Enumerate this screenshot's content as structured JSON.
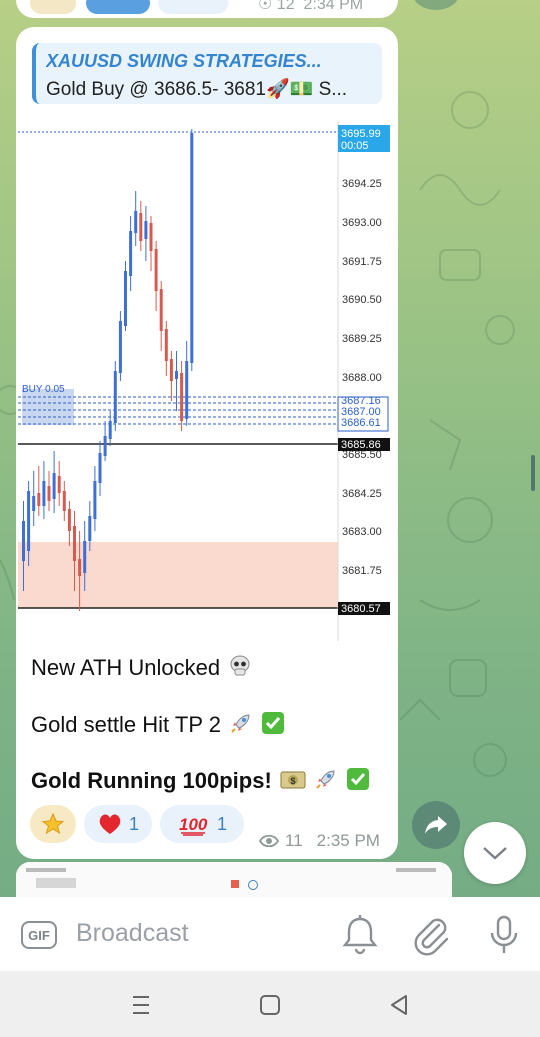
{
  "previous_message": {
    "views": "12",
    "time": "2:34 PM"
  },
  "reply": {
    "title": "XAUUSD SWING STRATEGIES...",
    "text": "Gold Buy @ 3686.5- 3681🚀💵 S..."
  },
  "chart": {
    "price_labels": [
      "3694.25",
      "3693.00",
      "3691.75",
      "3690.50",
      "3689.25",
      "3688.00",
      "3685.50",
      "3684.25",
      "3683.00",
      "3681.75"
    ],
    "tag_top_price": "3695.99",
    "tag_top_time": "00:05",
    "tag_orders": [
      "3687.16",
      "3687.00",
      "3686.61"
    ],
    "tag_current": "3685.86",
    "tag_bottom": "3680.57",
    "buy_label": "BUY 0.05"
  },
  "message": {
    "line1": "New ATH Unlocked",
    "line2": "Gold settle Hit TP 2",
    "line3": "Gold Running 100pips!"
  },
  "reactions": [
    {
      "icon": "star",
      "count": ""
    },
    {
      "icon": "heart",
      "count": "1"
    },
    {
      "icon": "hundred",
      "count": "1"
    }
  ],
  "meta": {
    "views": "11",
    "time": "2:35 PM"
  },
  "input": {
    "placeholder": "Broadcast",
    "gif_label": "GIF"
  },
  "colors": {
    "accent": "#3484cf",
    "reply_bg": "#e8f3fb",
    "bull": "#3f6fd4",
    "bear": "#d45b4f"
  }
}
